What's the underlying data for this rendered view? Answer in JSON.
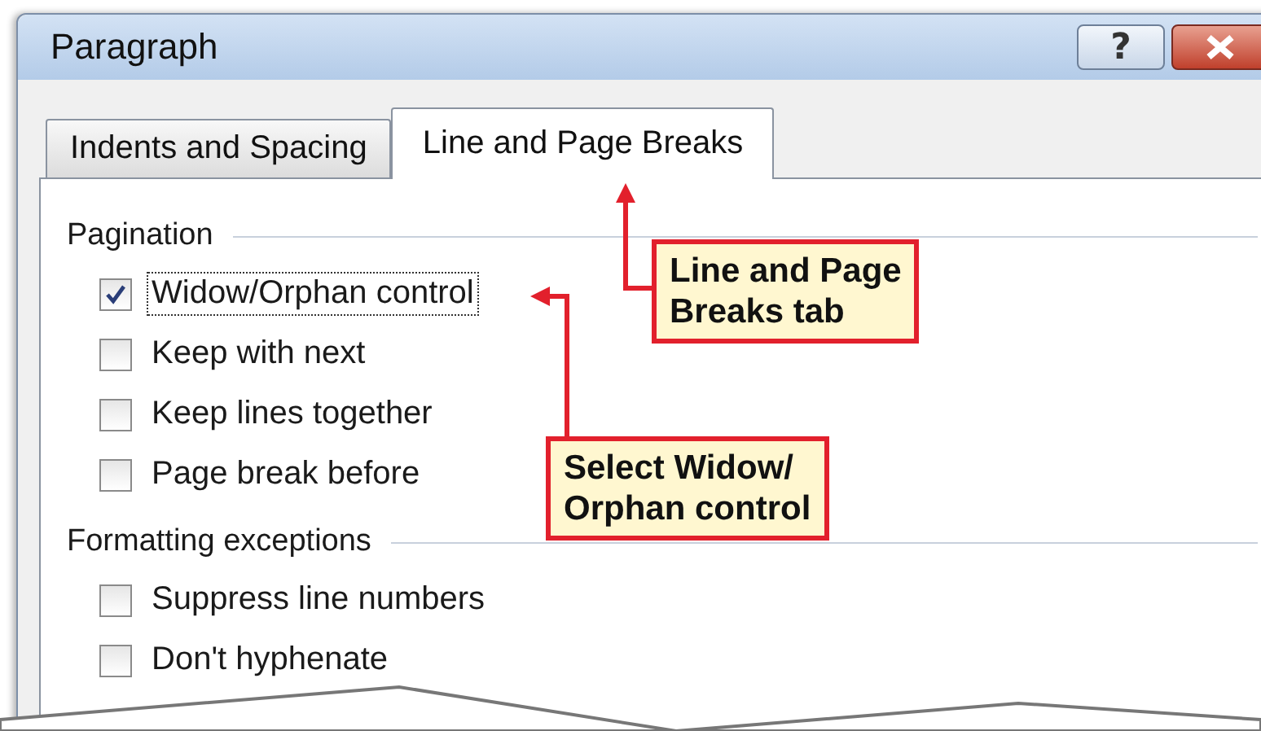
{
  "window": {
    "title": "Paragraph",
    "help_button": "?"
  },
  "tabs": [
    {
      "label": "Indents and Spacing",
      "selected": false
    },
    {
      "label": "Line and Page Breaks",
      "selected": true
    }
  ],
  "sections": [
    {
      "title": "Pagination",
      "options": [
        {
          "label": "Widow/Orphan control",
          "checked": true,
          "focused": true
        },
        {
          "label": "Keep with next",
          "checked": false,
          "focused": false
        },
        {
          "label": "Keep lines together",
          "checked": false,
          "focused": false
        },
        {
          "label": "Page break before",
          "checked": false,
          "focused": false
        }
      ]
    },
    {
      "title": "Formatting exceptions",
      "options": [
        {
          "label": "Suppress line numbers",
          "checked": false,
          "focused": false
        },
        {
          "label": "Don't hyphenate",
          "checked": false,
          "focused": false
        }
      ]
    }
  ],
  "callouts": [
    {
      "lines": [
        "Line and Page",
        "Breaks tab"
      ]
    },
    {
      "lines": [
        "Select Widow/",
        "Orphan control"
      ]
    }
  ]
}
